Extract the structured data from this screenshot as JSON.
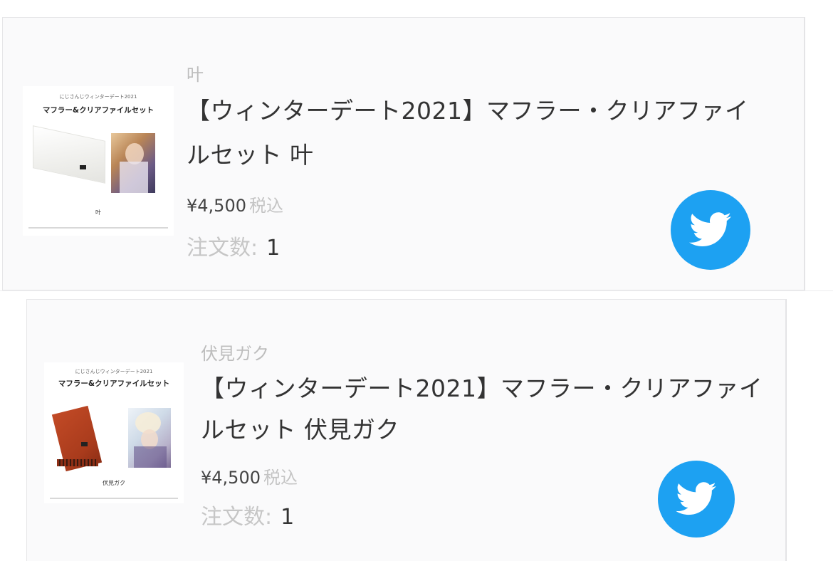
{
  "products": [
    {
      "character": "叶",
      "title_line1": "【ウィンターデート2021】マフラー・クリアファイ",
      "title_line2": "ルセット 叶",
      "price": "¥4,500",
      "tax_label": "税込",
      "order_label": "注文数:",
      "order_count": "1",
      "thumbnail": {
        "caption_small": "にじさんじウィンターデート2021",
        "caption_main": "マフラー&クリアファイルセット",
        "caption_name": "叶"
      }
    },
    {
      "character": "伏見ガク",
      "title_line1": "【ウィンターデート2021】マフラー・クリアファイ",
      "title_line2": "ルセット 伏見ガク",
      "price": "¥4,500",
      "tax_label": "税込",
      "order_label": "注文数:",
      "order_count": "1",
      "thumbnail": {
        "caption_small": "にじさんじウィンターデート2021",
        "caption_main": "マフラー&クリアファイルセット",
        "caption_name": "伏見ガク"
      }
    }
  ],
  "share": {
    "icon": "twitter-bird-icon",
    "color": "#1da1f2"
  }
}
